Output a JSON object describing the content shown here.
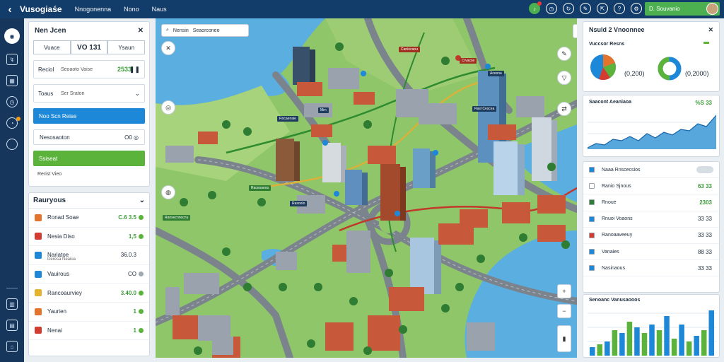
{
  "topbar": {
    "brand": "Vusogiaśe",
    "nav": [
      "Nnogonenna",
      "Nono",
      "Naus"
    ],
    "user_label": "D. Souvanio",
    "icons": [
      "notification-icon",
      "clock-icon",
      "refresh-icon",
      "edit-icon",
      "export-icon",
      "help-icon",
      "settings-icon"
    ]
  },
  "rail": {
    "icons": [
      "user-icon",
      "route-icon",
      "dashboard-icon",
      "clock-icon",
      "history-icon",
      "circle-icon"
    ],
    "bottom_icons": [
      "building-icon",
      "report-icon",
      "home-icon"
    ]
  },
  "left_panel": {
    "title": "Nen Jcen",
    "tabs": [
      "Vuace",
      "VO 131",
      "Ysaun"
    ],
    "field1": {
      "label": "Reciol",
      "sub": "Seoaoto Vaise",
      "value": "2533"
    },
    "field2": {
      "label": "Toaus",
      "sub": "Ser Sraton"
    },
    "btn_blue": "Noo Scn Reise",
    "btn_outline": "Nesosaoton",
    "btn_outline_right": "O0 ◎",
    "btn_green": "Ssiseat",
    "footer": "Rerist Vieo"
  },
  "left_list": {
    "title": "Rauryous",
    "items": [
      {
        "label": "Ronad Soae",
        "value": "C.6 3.5",
        "color": "#e4742c",
        "dot": "#5bb33b"
      },
      {
        "label": "Nesia Diso",
        "value": "1,5",
        "color": "#d33c30",
        "dot": "#5bb33b"
      },
      {
        "label": "Nariatoe",
        "sub": "Deresa Neaiua",
        "value": "36.0.3",
        "color": "#1e88d8",
        "dot": ""
      },
      {
        "label": "Vauirous",
        "value": "CO",
        "color": "#1e88d8",
        "dot": "#a0a8b0"
      },
      {
        "label": "Rancoaurviey",
        "value": "3.40.0",
        "color": "#e4b22c",
        "dot": "#5bb33b"
      },
      {
        "label": "Yaurien",
        "value": "1",
        "color": "#e4742c",
        "dot": "#5bb33b"
      },
      {
        "label": "Nenai",
        "value": "1",
        "color": "#d33c30",
        "dot": "#5bb33b"
      }
    ]
  },
  "map": {
    "search_text": "Nensin",
    "search_tag": "Seaorconeo",
    "labels": [
      {
        "text": "Caniocaou",
        "type": "red"
      },
      {
        "text": "Crvacse",
        "type": "red"
      },
      {
        "text": "Rasl Cescea",
        "type": "blue"
      },
      {
        "text": "Mrn",
        "type": "blue"
      },
      {
        "text": "Rocaenaie",
        "type": "blue"
      },
      {
        "text": "Racesaeoo",
        "type": "green"
      },
      {
        "text": "Ransecnnocnu",
        "type": "green"
      },
      {
        "text": "Rasoolo",
        "type": "blue"
      },
      {
        "text": "Acesnu",
        "type": "blue"
      }
    ]
  },
  "right_panel": {
    "title": "Nsuld 2 Vnoonnee",
    "subtitle": "Vuccsor Resns",
    "donut1_value": "(0,200)",
    "donut2_value": "(0,2000)",
    "pie_colors": [
      "#1e88d8",
      "#e4742c",
      "#5bb33b",
      "#d33c30"
    ]
  },
  "right_trend": {
    "title": "Saacont Aeaniaoa",
    "value": "%S 33"
  },
  "right_list": {
    "items": [
      {
        "label": "Naaa Rnscecsios",
        "value": "",
        "color": "#1e88d8",
        "toggle": true
      },
      {
        "label": "Ranio Sjnous",
        "value": "63 33",
        "color": "#ffffff"
      },
      {
        "label": "Rnoue",
        "value": "2303",
        "color": "#2f7d32"
      },
      {
        "label": "Rnuoi Voaons",
        "value": "33 33",
        "color": "#1e88d8"
      },
      {
        "label": "Ranoaaveeuy",
        "value": "33 33",
        "color": "#d33c30"
      },
      {
        "label": "Vanaies",
        "value": "88 33",
        "color": "#1e88d8"
      },
      {
        "label": "Nasinaous",
        "value": "33 33",
        "color": "#1e88d8"
      }
    ]
  },
  "right_bars": {
    "title": "Senoanc Vanusaooos",
    "colors": [
      "#1e88d8",
      "#5bb33b"
    ],
    "values": [
      3,
      4,
      5,
      9,
      8,
      12,
      10,
      8,
      11,
      9,
      14,
      6,
      11,
      5,
      7,
      9,
      16
    ]
  }
}
